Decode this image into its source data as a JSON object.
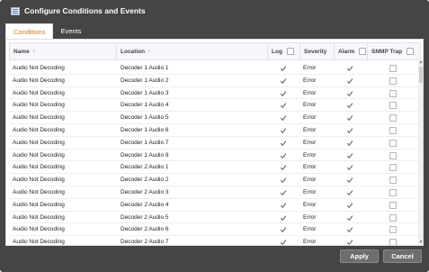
{
  "dialog": {
    "title": "Configure Conditions and Events",
    "title_icon": "list-window-icon"
  },
  "tabs": [
    {
      "label": "Conditions",
      "active": true
    },
    {
      "label": "Events",
      "active": false
    }
  ],
  "table": {
    "headers": {
      "name": "Name",
      "location": "Location",
      "log": "Log",
      "severity": "Severity",
      "alarm": "Alarm",
      "snmp": "SNMP Trap"
    },
    "sort_icon": "↑",
    "rows": [
      {
        "name": "Audio Not Decoding",
        "location": "Decoder 1 Audio 1",
        "log": true,
        "severity": "Error",
        "alarm": true,
        "snmp": false
      },
      {
        "name": "Audio Not Decoding",
        "location": "Decoder 1 Audio 2",
        "log": true,
        "severity": "Error",
        "alarm": true,
        "snmp": false
      },
      {
        "name": "Audio Not Decoding",
        "location": "Decoder 1 Audio 3",
        "log": true,
        "severity": "Error",
        "alarm": true,
        "snmp": false
      },
      {
        "name": "Audio Not Decoding",
        "location": "Decoder 1 Audio 4",
        "log": true,
        "severity": "Error",
        "alarm": true,
        "snmp": false
      },
      {
        "name": "Audio Not Decoding",
        "location": "Decoder 1 Audio 5",
        "log": true,
        "severity": "Error",
        "alarm": true,
        "snmp": false
      },
      {
        "name": "Audio Not Decoding",
        "location": "Decoder 1 Audio 6",
        "log": true,
        "severity": "Error",
        "alarm": true,
        "snmp": false
      },
      {
        "name": "Audio Not Decoding",
        "location": "Decoder 1 Audio 7",
        "log": true,
        "severity": "Error",
        "alarm": true,
        "snmp": false
      },
      {
        "name": "Audio Not Decoding",
        "location": "Decoder 1 Audio 8",
        "log": true,
        "severity": "Error",
        "alarm": true,
        "snmp": false
      },
      {
        "name": "Audio Not Decoding",
        "location": "Decoder 2 Audio 1",
        "log": true,
        "severity": "Error",
        "alarm": true,
        "snmp": false
      },
      {
        "name": "Audio Not Decoding",
        "location": "Decoder 2 Audio 2",
        "log": true,
        "severity": "Error",
        "alarm": true,
        "snmp": false
      },
      {
        "name": "Audio Not Decoding",
        "location": "Decoder 2 Audio 3",
        "log": true,
        "severity": "Error",
        "alarm": true,
        "snmp": false
      },
      {
        "name": "Audio Not Decoding",
        "location": "Decoder 2 Audio 4",
        "log": true,
        "severity": "Error",
        "alarm": true,
        "snmp": false
      },
      {
        "name": "Audio Not Decoding",
        "location": "Decoder 2 Audio 5",
        "log": true,
        "severity": "Error",
        "alarm": true,
        "snmp": false
      },
      {
        "name": "Audio Not Decoding",
        "location": "Decoder 2 Audio 6",
        "log": true,
        "severity": "Error",
        "alarm": true,
        "snmp": false
      },
      {
        "name": "Audio Not Decoding",
        "location": "Decoder 2 Audio 7",
        "log": true,
        "severity": "Error",
        "alarm": true,
        "snmp": false
      }
    ]
  },
  "buttons": {
    "apply": "Apply",
    "cancel": "Cancel"
  },
  "colors": {
    "dialog_bg": "#454545",
    "active_tab_text": "#d07a1a",
    "button_bg": "#6d6d6d"
  }
}
